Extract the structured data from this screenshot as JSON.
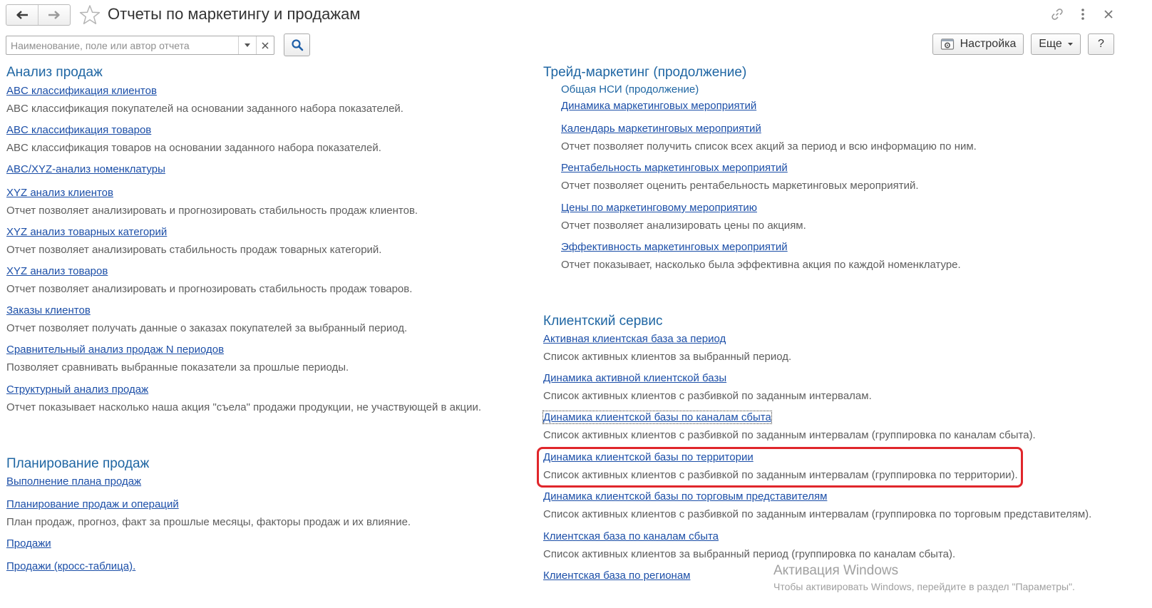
{
  "window": {
    "title": "Отчеты по маркетингу и продажам"
  },
  "toolbar": {
    "search_placeholder": "Наименование, поле или автор отчета",
    "settings_label": "Настройка",
    "more_label": "Еще",
    "help_label": "?"
  },
  "icons": {
    "back": "arrow-left",
    "forward": "arrow-right",
    "favorite": "star",
    "link": "link",
    "menu": "vertical-dots",
    "close": "close",
    "dropdown": "triangle-down",
    "clear": "x",
    "search": "magnifier",
    "settings": "gear"
  },
  "colors": {
    "section_title": "#1f66a3",
    "link": "#1c4fa8",
    "description": "#5e5e5e",
    "highlight": "#e0262b"
  },
  "sections": {
    "sales_analysis": {
      "title": "Анализ продаж",
      "items": [
        {
          "link": "ABC классификация клиентов",
          "desc": "ABC классификация покупателей на основании заданного набора показателей."
        },
        {
          "link": "ABC классификация товаров",
          "desc": "ABC классификация товаров на основании заданного набора показателей."
        },
        {
          "link": "ABC/XYZ-анализ номенклатуры"
        },
        {
          "link": "XYZ анализ клиентов",
          "desc": "Отчет позволяет анализировать и прогнозировать стабильность продаж клиентов."
        },
        {
          "link": "XYZ анализ товарных категорий",
          "desc": "Отчет позволяет анализировать стабильность продаж товарных категорий."
        },
        {
          "link": "XYZ анализ товаров",
          "desc": "Отчет позволяет анализировать и прогнозировать стабильность продаж товаров."
        },
        {
          "link": "Заказы клиентов",
          "desc": "Отчет позволяет получать данные о заказах покупателей за выбранный период."
        },
        {
          "link": "Сравнительный анализ продаж N периодов",
          "desc": "Позволяет сравнивать выбранные показатели за прошлые периоды."
        },
        {
          "link": "Структурный анализ продаж",
          "desc": "Отчет показывает насколько наша акция \"съела\" продажи продукции, не участвующей в акции."
        }
      ]
    },
    "sales_planning": {
      "title": "Планирование продаж",
      "items": [
        {
          "link": "Выполнение плана продаж"
        },
        {
          "link": "Планирование продаж и операций",
          "desc": "План продаж, прогноз, факт за прошлые месяцы, факторы продаж и их влияние."
        },
        {
          "link": "Продажи"
        },
        {
          "link": "Продажи (кросс-таблица)."
        }
      ]
    },
    "trade_marketing": {
      "title": "Трейд-маркетинг (продолжение)",
      "subtitle": "Общая НСИ (продолжение)",
      "items": [
        {
          "link": "Динамика маркетинговых мероприятий"
        },
        {
          "link": "Календарь маркетинговых мероприятий",
          "desc": "Отчет позволяет получить список всех акций за период и всю информацию по ним."
        },
        {
          "link": "Рентабельность маркетинговых мероприятий",
          "desc": "Отчет позволяет оценить рентабельность маркетинговых мероприятий."
        },
        {
          "link": "Цены по маркетинговому мероприятию",
          "desc": "Отчет позволяет анализировать цены по акциям."
        },
        {
          "link": "Эффективность маркетинговых мероприятий",
          "desc": "Отчет показывает, насколько была эффективна акция по каждой номенклатуре."
        }
      ]
    },
    "client_service": {
      "title": "Клиентский сервис",
      "items": [
        {
          "link": "Активная клиентская база за период",
          "desc": "Список активных клиентов за выбранный период."
        },
        {
          "link": "Динамика активной клиентской базы",
          "desc": "Список активных клиентов с разбивкой по заданным интервалам."
        },
        {
          "link": "Динамика клиентской базы по каналам сбыта",
          "desc": "Список активных клиентов с разбивкой по заданным интервалам (группировка по каналам сбыта)."
        },
        {
          "link": "Динамика клиентской базы по территории",
          "desc": "Список активных клиентов с разбивкой по заданным интервалам (группировка по территории)."
        },
        {
          "link": "Динамика клиентской базы по торговым представителям",
          "desc": "Список активных клиентов с разбивкой по заданным интервалам (группировка по торговым представителям)."
        },
        {
          "link": "Клиентская база по каналам сбыта",
          "desc": "Список активных клиентов за выбранный период (группировка по каналам сбыта)."
        },
        {
          "link": "Клиентская база по регионам"
        }
      ]
    }
  },
  "watermark": {
    "title": "Активация Windows",
    "subtitle": "Чтобы активировать Windows, перейдите в раздел \"Параметры\"."
  }
}
